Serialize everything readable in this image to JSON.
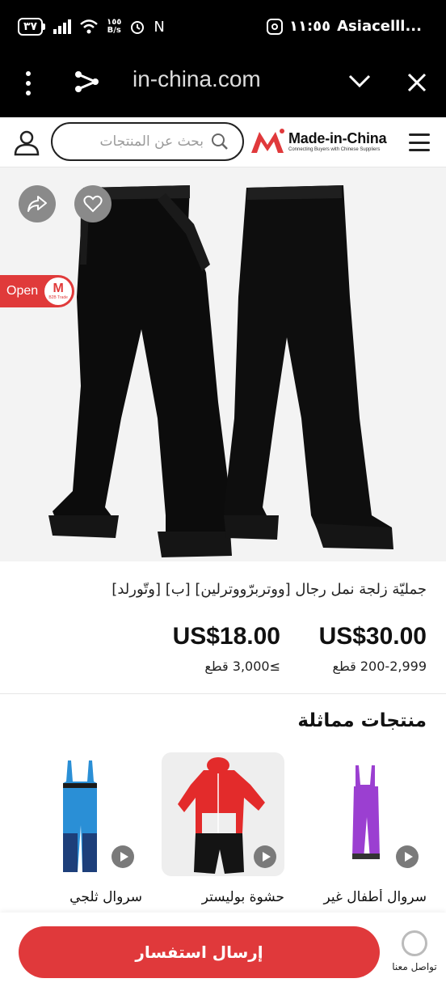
{
  "status_bar": {
    "battery": "٣٧",
    "net_speed_top": "١٥٥",
    "net_speed_bottom": "B/s",
    "nfc": "N",
    "time": "١١:٥٥",
    "carrier": "Asiacelll..."
  },
  "browser": {
    "url": "in-china.com"
  },
  "header": {
    "search_placeholder": "بحث عن المنتجات",
    "logo_name": "Made-in-China",
    "logo_tagline": "Connecting Buyers with Chinese Suppliers"
  },
  "product": {
    "open_label": "Open",
    "badge_mark": "M",
    "badge_text": "B2B Trade",
    "title": "جمليّة زلجة نمل رجال [ووتربرّووترلين] [ب] [وتّورلد]",
    "prices": [
      {
        "price": "US$30.00",
        "qty": "200-2,999 قطع"
      },
      {
        "price": "US$18.00",
        "qty": "≥3,000 قطع"
      }
    ]
  },
  "similar": {
    "title": "منتجات مماثلة",
    "items": [
      {
        "name": "سروال أطفال غير"
      },
      {
        "name": "حشوة بوليستر"
      },
      {
        "name": "سروال ثلجي"
      }
    ]
  },
  "bottom": {
    "inquiry_label": "إرسال استفسار",
    "contact_label": "تواصل معنا"
  },
  "colors": {
    "brand_red": "#e0393b",
    "background": "#f3f3f3"
  }
}
